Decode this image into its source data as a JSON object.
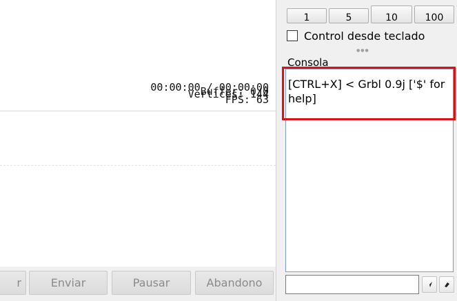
{
  "viewer": {
    "time": "00:00:00 / 00:00:00",
    "buffer": "Buffer: 0/0",
    "vertices": "Vertices: 144",
    "fps": "FPS: 63"
  },
  "buttons": {
    "partial": "r",
    "send": "Enviar",
    "pause": "Pausar",
    "abort": "Abandono"
  },
  "jog": {
    "steps": [
      "1",
      "5",
      "10",
      "100"
    ]
  },
  "keyboard_control": {
    "label": "Control desde teclado",
    "checked": false
  },
  "console": {
    "title": "Consola",
    "text": "[CTRL+X] < Grbl 0.9j ['$' for help]"
  },
  "command": {
    "value": "",
    "send_icon": "send-arrow-icon",
    "clear_icon": "clear-icon"
  }
}
